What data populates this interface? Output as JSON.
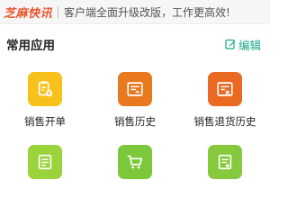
{
  "notice": {
    "brand": "芝麻快讯",
    "text": "客户端全面升级改版，工作更高效!",
    "brand_color": "#e8552f"
  },
  "section": {
    "title": "常用应用",
    "edit_label": "编辑",
    "accent_color": "#1aa889"
  },
  "apps": [
    {
      "label": "销售开单",
      "icon": "sales-order-icon",
      "color": "#f7c11a"
    },
    {
      "label": "销售历史",
      "icon": "sales-history-icon",
      "color": "#e8791f"
    },
    {
      "label": "销售退货历史",
      "icon": "sales-return-history-icon",
      "color": "#ea6a24"
    },
    {
      "label": "",
      "icon": "inventory-report-icon",
      "color": "#9bd33a"
    },
    {
      "label": "",
      "icon": "shopping-cart-icon",
      "color": "#7cc83a"
    },
    {
      "label": "",
      "icon": "purchase-record-icon",
      "color": "#86c93c"
    }
  ]
}
